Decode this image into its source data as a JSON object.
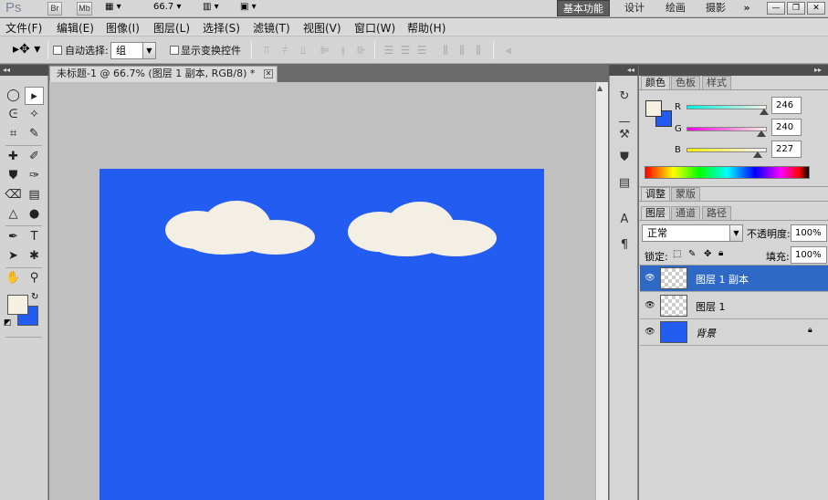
{
  "app": {
    "logo": "Ps",
    "bridge_btn": "Br",
    "minibridge_btn": "Mb",
    "zoom": "66.7",
    "workspaces": [
      "基本功能",
      "设计",
      "绘画",
      "摄影"
    ],
    "more": "»"
  },
  "menu": [
    "文件(F)",
    "编辑(E)",
    "图像(I)",
    "图层(L)",
    "选择(S)",
    "滤镜(T)",
    "视图(V)",
    "窗口(W)",
    "帮助(H)"
  ],
  "options": {
    "auto_select_label": "自动选择:",
    "auto_select_value": "组",
    "show_transform_label": "显示变换控件"
  },
  "document": {
    "tab_title": "未标题-1 @ 66.7% (图层 1 副本, RGB/8) *",
    "canvas_color": "#225cf0",
    "cloud_color": "#f3efe5"
  },
  "color_panel": {
    "tabs": [
      "颜色",
      "色板",
      "样式"
    ],
    "channels": [
      {
        "label": "R",
        "value": "246"
      },
      {
        "label": "G",
        "value": "240"
      },
      {
        "label": "B",
        "value": "227"
      }
    ],
    "foreground": "#f6f0e3",
    "background": "#225cf0"
  },
  "adjust_panel": {
    "tabs": [
      "调整",
      "蒙版"
    ]
  },
  "layers_panel": {
    "tabs": [
      "图层",
      "通道",
      "路径"
    ],
    "blend_mode": "正常",
    "opacity_label": "不透明度:",
    "opacity_value": "100%",
    "lock_label": "锁定:",
    "fill_label": "填充:",
    "fill_value": "100%",
    "layers": [
      {
        "name": "图层 1 副本",
        "selected": true
      },
      {
        "name": "图层 1",
        "selected": false
      },
      {
        "name": "背景",
        "selected": false
      }
    ]
  }
}
